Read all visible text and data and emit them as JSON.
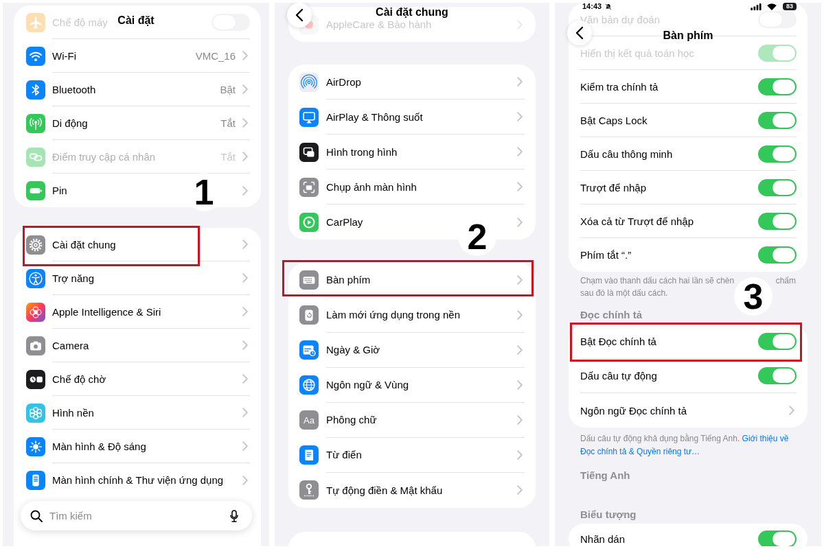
{
  "panels": [
    {
      "title": "Cài đặt",
      "back_button": false,
      "step_badge": "1",
      "more_card_below": false,
      "groups": [
        {
          "rows": [
            {
              "label": "Chế độ máy",
              "kind": "toggle",
              "on": false,
              "faded": true,
              "disabled": false
            },
            {
              "label": "Wi-Fi",
              "kind": "link",
              "value": "VMC_16",
              "faded": false,
              "disabled": false
            },
            {
              "label": "Bluetooth",
              "kind": "link",
              "value": "Bật",
              "faded": false,
              "disabled": false
            },
            {
              "label": "Di động",
              "kind": "link",
              "value": "Tắt",
              "faded": false,
              "disabled": false
            },
            {
              "label": "Điểm truy cập cá nhân",
              "kind": "link",
              "value": "Tắt",
              "faded": false,
              "disabled": true
            },
            {
              "label": "Pin",
              "kind": "link",
              "faded": false,
              "disabled": false
            }
          ]
        },
        {
          "rows": [
            {
              "label": "Cài đặt chung",
              "kind": "link",
              "highlighted": true
            },
            {
              "label": "Trợ năng",
              "kind": "link",
              "highlighted": false
            },
            {
              "label": "Apple Intelligence & Siri",
              "kind": "link",
              "highlighted": false
            },
            {
              "label": "Camera",
              "kind": "link",
              "highlighted": false
            },
            {
              "label": "Chế độ chờ",
              "kind": "link",
              "highlighted": false
            },
            {
              "label": "Hình nền",
              "kind": "link",
              "highlighted": false
            },
            {
              "label": "Màn hình & Độ sáng",
              "kind": "link",
              "highlighted": false
            },
            {
              "label": "Màn hình chính & Thư viện ứng dụng",
              "kind": "link",
              "highlighted": false
            }
          ]
        }
      ],
      "search": {
        "placeholder": "Tìm kiếm"
      }
    },
    {
      "title": "Cài đặt chung",
      "back_button": true,
      "step_badge": "2",
      "more_card_below": true,
      "groups": [
        {
          "rows": [
            {
              "label": "AppleCare & Bảo hành",
              "kind": "link",
              "faded": true
            }
          ]
        },
        {
          "rows": [
            {
              "label": "AirDrop",
              "kind": "link"
            },
            {
              "label": "AirPlay & Thông suốt",
              "kind": "link"
            },
            {
              "label": "Hình trong hình",
              "kind": "link"
            },
            {
              "label": "Chụp ảnh màn hình",
              "kind": "link"
            },
            {
              "label": "CarPlay",
              "kind": "link"
            }
          ]
        },
        {
          "rows": [
            {
              "label": "Bàn phím",
              "kind": "link",
              "highlighted": true
            },
            {
              "label": "Làm mới ứng dụng trong nền",
              "kind": "link",
              "highlighted": false
            },
            {
              "label": "Ngày & Giờ",
              "kind": "link",
              "highlighted": false
            },
            {
              "label": "Ngôn ngữ & Vùng",
              "kind": "link",
              "highlighted": false
            },
            {
              "label": "Phông chữ",
              "kind": "link",
              "icon_text": "Aa",
              "highlighted": false
            },
            {
              "label": "Từ điển",
              "kind": "link",
              "highlighted": false
            },
            {
              "label": "Tự động điền & Mật khẩu",
              "kind": "link",
              "highlighted": false
            }
          ]
        }
      ]
    },
    {
      "status_bar": {
        "time": "14:43",
        "battery": "83"
      },
      "title": "Bàn phím",
      "back_button": true,
      "step_badge": "3",
      "more_card_below": false,
      "groups": [
        {
          "rows": [
            {
              "label": "Văn bản dự đoán",
              "kind": "toggle",
              "on": false,
              "faded": true
            },
            {
              "label": "Hiển thị kết quả toán học",
              "kind": "toggle",
              "on": true,
              "faded": true
            },
            {
              "label": "Kiểm tra chính tả",
              "kind": "toggle",
              "on": true,
              "faded": false
            },
            {
              "label": "Bật Caps Lock",
              "kind": "toggle",
              "on": true,
              "faded": false
            },
            {
              "label": "Dấu câu thông minh",
              "kind": "toggle",
              "on": true,
              "faded": false
            },
            {
              "label": "Trượt để nhập",
              "kind": "toggle",
              "on": true,
              "faded": false
            },
            {
              "label": "Xóa cả từ Trượt để nhập",
              "kind": "toggle",
              "on": true,
              "faded": false
            },
            {
              "label": "Phím tắt “.”",
              "kind": "toggle",
              "on": true,
              "faded": false
            }
          ],
          "footer": {
            "kind": "split",
            "parts": [
              "Chạm vào thanh dấu cách hai lần sẽ chèn",
              "chấm",
              "sau đó là một dấu cách."
            ]
          }
        },
        {
          "header": "Đọc chính tả",
          "rows": [
            {
              "label": "Bật Đọc chính tả",
              "kind": "toggle",
              "on": true,
              "highlighted": true
            },
            {
              "label": "Dấu câu tự động",
              "kind": "toggle",
              "on": true,
              "highlighted": false
            },
            {
              "label": "Ngôn ngữ Đọc chính tả",
              "kind": "link",
              "highlighted": false
            }
          ],
          "footer": {
            "kind": "link",
            "text": "Dấu câu tự động khả dụng bằng Tiếng Anh.",
            "link_lines": [
              "Giới thiệu về",
              "Đọc chính tả & Quyền riêng tư…"
            ]
          }
        },
        {
          "header": "Tiếng Anh"
        },
        {
          "header": "Biểu tượng",
          "rows": [
            {
              "label": "Nhãn dán",
              "kind": "toggle",
              "on": true
            }
          ]
        }
      ]
    }
  ]
}
